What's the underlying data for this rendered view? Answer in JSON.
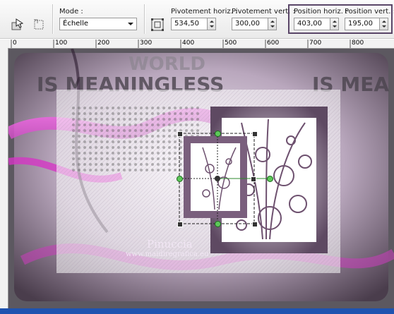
{
  "toolbar": {
    "mode_label": "Mode :",
    "mode_value": "Échelle",
    "pivot_h_label": "Pivotement horiz. :",
    "pivot_h_value": "534,50",
    "pivot_v_label": "Pivotement vert. :",
    "pivot_v_value": "300,00",
    "pos_h_label": "Position horiz. :",
    "pos_h_value": "403,00",
    "pos_v_label": "Position vert. :",
    "pos_v_value": "195,00"
  },
  "ruler": {
    "marks": [
      "0",
      "100",
      "200",
      "300",
      "400",
      "500",
      "600",
      "700",
      "800"
    ]
  },
  "canvas": {
    "watermark_title": "Pinuccia",
    "watermark_url": "www.maidiregrafica.eu",
    "background_text_top": "IS MEANINGLESS",
    "background_text_ghost": "WORLD",
    "background_text_right": "IS MEA"
  },
  "colors": {
    "highlight_border": "#5a4668",
    "frame_purple": "#7a5f7d",
    "magenta": "#d436c4",
    "bottom_bar": "#1f53b0"
  },
  "icons": [
    "pick-icon",
    "rotate-icon",
    "anchor-icon"
  ]
}
